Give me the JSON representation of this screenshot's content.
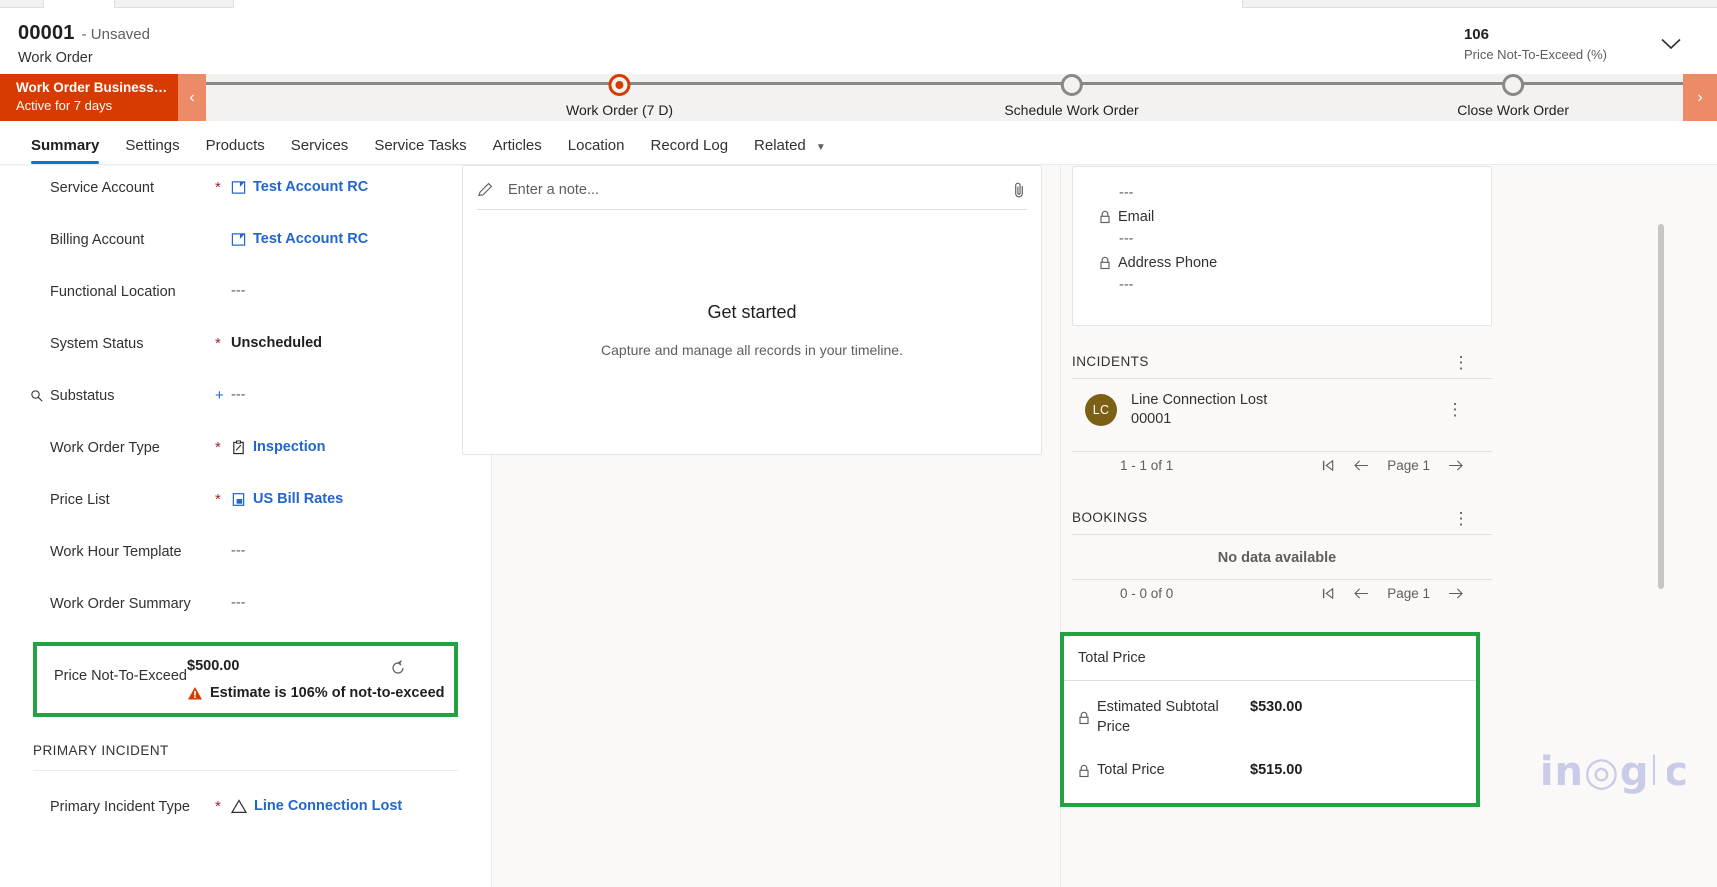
{
  "header": {
    "record_id": "00001",
    "unsaved": "- Unsaved",
    "entity": "Work Order",
    "hdr_value": "106",
    "hdr_label": "Price Not-To-Exceed (%)",
    "chevron_icon": "chevron-down-icon"
  },
  "bpf": {
    "name": "Work Order Business Pro...",
    "duration": "Active for 7 days",
    "prev_icon": "chevron-left-icon",
    "next_icon": "chevron-right-icon",
    "stages": [
      {
        "label": "Work Order",
        "duration": "(7 D)",
        "active": true
      },
      {
        "label": "Schedule Work Order",
        "duration": "",
        "active": false
      },
      {
        "label": "Close Work Order",
        "duration": "",
        "active": false
      }
    ]
  },
  "tabs": [
    {
      "label": "Summary",
      "selected": true
    },
    {
      "label": "Settings",
      "selected": false
    },
    {
      "label": "Products",
      "selected": false
    },
    {
      "label": "Services",
      "selected": false
    },
    {
      "label": "Service Tasks",
      "selected": false
    },
    {
      "label": "Articles",
      "selected": false
    },
    {
      "label": "Location",
      "selected": false
    },
    {
      "label": "Record Log",
      "selected": false
    },
    {
      "label": "Related",
      "selected": false,
      "has_chevron": true
    }
  ],
  "left_form": {
    "fields": [
      {
        "label": "Service Account",
        "required": "*",
        "value": "Test Account RC",
        "link": true,
        "icon": "account-icon"
      },
      {
        "label": "Billing Account",
        "required": "",
        "value": "Test Account RC",
        "link": true,
        "icon": "account-icon"
      },
      {
        "label": "Functional Location",
        "required": "",
        "value": "---",
        "link": false,
        "icon": ""
      },
      {
        "label": "System Status",
        "required": "*",
        "value": "Unscheduled",
        "link": false,
        "icon": "",
        "bold": true
      },
      {
        "label": "Substatus",
        "required": "+",
        "value": "---",
        "link": false,
        "icon": "",
        "prefix_icon": "magnifier-icon"
      },
      {
        "label": "Work Order Type",
        "required": "*",
        "value": "Inspection",
        "link": true,
        "icon": "clipboard-icon"
      },
      {
        "label": "Price List",
        "required": "*",
        "value": "US Bill Rates",
        "link": true,
        "icon": "pricelist-icon"
      },
      {
        "label": "Work Hour Template",
        "required": "",
        "value": "---",
        "link": false,
        "icon": ""
      },
      {
        "label": "Work Order Summary",
        "required": "",
        "value": "---",
        "link": false,
        "icon": ""
      }
    ],
    "price_not_to_exceed": {
      "label": "Price Not-To-Exceed",
      "amount": "$500.00",
      "warning": "Estimate is 106% of not-to-exceed",
      "warning_icon": "warning-triangle-icon",
      "refresh_icon": "refresh-icon",
      "highlight_color": "#21a341"
    },
    "primary_incident": {
      "section_title": "PRIMARY INCIDENT",
      "label": "Primary Incident Type",
      "required": "*",
      "value": "Line Connection Lost",
      "icon": "incident-warning-icon"
    }
  },
  "timeline": {
    "note_placeholder": "Enter a note...",
    "note_icon": "pencil-icon",
    "attach_icon": "paperclip-icon",
    "empty_title": "Get started",
    "empty_subtitle": "Capture and manage all records in your timeline."
  },
  "right_panel": {
    "contact": {
      "rows": [
        {
          "value": "---",
          "label": "Email",
          "icon": "lock-icon"
        },
        {
          "value": "---",
          "label": "Address Phone",
          "icon": "lock-icon"
        },
        {
          "value": "---",
          "label": "",
          "icon": ""
        }
      ]
    },
    "incidents": {
      "title": "INCIDENTS",
      "kebab_icon": "more-vertical-icon",
      "items": [
        {
          "initials": "LC",
          "name": "Line Connection Lost",
          "number": "00001",
          "kebab_icon": "more-vertical-icon"
        }
      ],
      "pager": {
        "count": "1 - 1 of 1",
        "first_icon": "page-first-icon",
        "prev_icon": "arrow-left-icon",
        "page_label": "Page 1",
        "next_icon": "arrow-right-icon"
      }
    },
    "bookings": {
      "title": "BOOKINGS",
      "kebab_icon": "more-vertical-icon",
      "empty": "No data available",
      "pager": {
        "count": "0 - 0 of 0",
        "first_icon": "page-first-icon",
        "prev_icon": "arrow-left-icon",
        "page_label": "Page 1",
        "next_icon": "arrow-right-icon"
      }
    },
    "total_price": {
      "title": "Total Price",
      "highlight_color": "#21a341",
      "rows": [
        {
          "label": "Estimated Subtotal Price",
          "value": "$530.00",
          "icon": "lock-icon"
        },
        {
          "label": "Total Price",
          "value": "$515.00",
          "icon": "lock-icon"
        }
      ]
    }
  },
  "watermark": {
    "text": "in◎glc"
  },
  "colors": {
    "accent": "#0078d4",
    "bpf_active": "#d83b01",
    "link": "#2266cc",
    "highlight": "#21a341",
    "warning": "#d83b01"
  }
}
